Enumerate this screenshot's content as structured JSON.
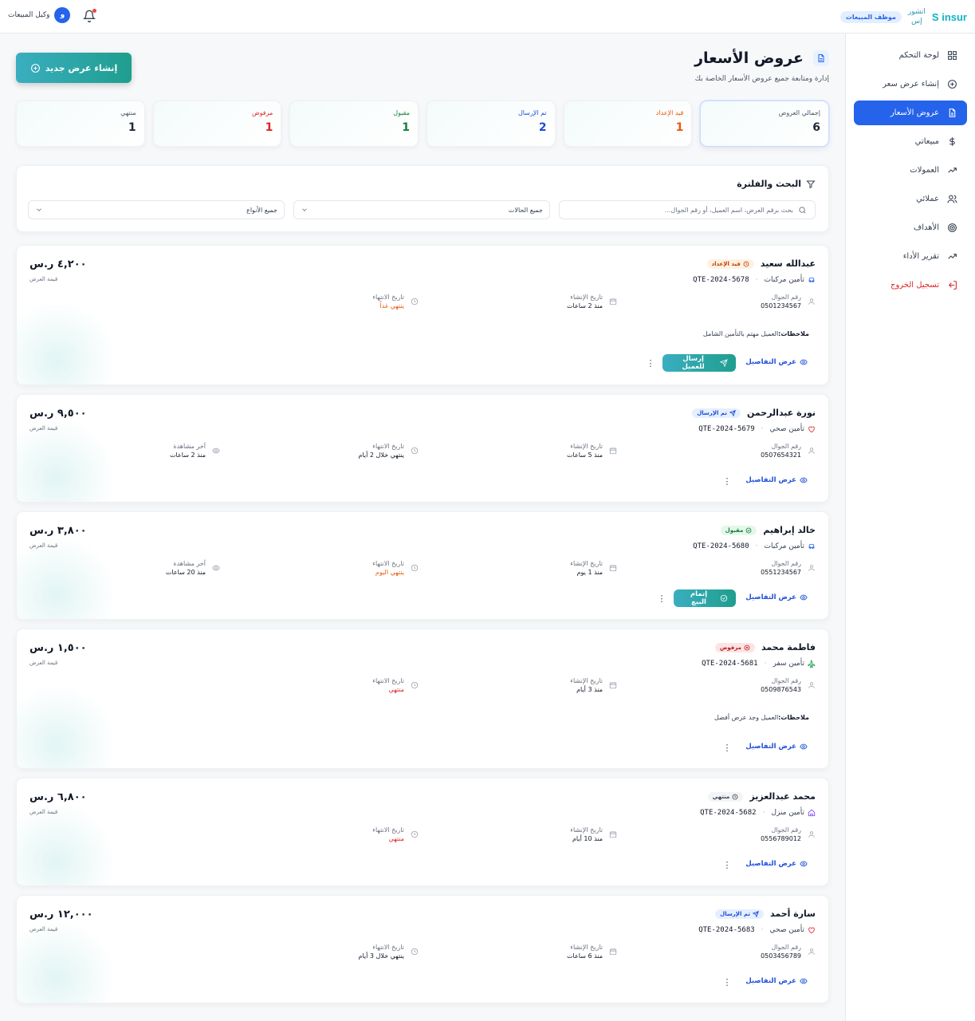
{
  "brand": {
    "name_en": "S insur",
    "name_ar_line1": "انشور",
    "name_ar_line2": "إس",
    "role": "موظف المبيعات"
  },
  "user": {
    "name": "وكيل المبيعات",
    "initial": "و"
  },
  "sidebar": {
    "items": [
      {
        "label": "لوحة التحكم",
        "icon": "dashboard-icon"
      },
      {
        "label": "إنشاء عرض سعر",
        "icon": "plus-circle-icon"
      },
      {
        "label": "عروض الأسعار",
        "icon": "document-icon"
      },
      {
        "label": "مبيعاتي",
        "icon": "dollar-icon"
      },
      {
        "label": "العمولات",
        "icon": "trend-icon"
      },
      {
        "label": "عملائي",
        "icon": "users-icon"
      },
      {
        "label": "الأهداف",
        "icon": "target-icon"
      },
      {
        "label": "تقرير الأداء",
        "icon": "chart-trend-icon"
      },
      {
        "label": "تسجيل الخروج",
        "icon": "logout-icon"
      }
    ]
  },
  "page": {
    "title": "عروض الأسعار",
    "subtitle": "إدارة ومتابعة جميع عروض الأسعار الخاصة بك",
    "create_label": "إنشاء عرض جديد"
  },
  "stats": [
    {
      "label": "إجمالي العروض",
      "value": "6",
      "color": "#111827"
    },
    {
      "label": "قيد الإعداد",
      "value": "1",
      "color": "#ea580c"
    },
    {
      "label": "تم الإرسال",
      "value": "2",
      "color": "#1d4ed8"
    },
    {
      "label": "مقبول",
      "value": "1",
      "color": "#15803d"
    },
    {
      "label": "مرفوض",
      "value": "1",
      "color": "#dc2626"
    },
    {
      "label": "منتهي",
      "value": "1",
      "color": "#374151"
    }
  ],
  "filter": {
    "title": "البحث والفلترة",
    "search_placeholder": "بحث برقم العرض، اسم العميل، أو رقم الجوال...",
    "status_select": "جميع الحالات",
    "type_select": "جميع الأنواع"
  },
  "labels": {
    "phone": "رقم الجوال",
    "created": "تاريخ الإنشاء",
    "expires": "تاريخ الانتهاء",
    "viewed": "آخر مشاهدة",
    "amount": "قيمة العرض",
    "notes": "ملاحظات:",
    "details": "عرض التفاصيل",
    "kebab": "⋮"
  },
  "quotes": [
    {
      "name": "عبدالله سعيد",
      "status": "قيد الإعداد",
      "type": "تأمين مركبات",
      "number": "QTE-2024-5678",
      "phone": "0501234567",
      "created": "منذ 2 ساعات",
      "expires": "ينتهي غداً",
      "amount": "٤,٢٠٠ ر.س",
      "notes": "العميل مهتم بالتأمين الشامل",
      "action": "إرسال للعميل"
    },
    {
      "name": "نورة عبدالرحمن",
      "status": "تم الإرسال",
      "type": "تأمين صحي",
      "number": "QTE-2024-5679",
      "phone": "0507654321",
      "created": "منذ 5 ساعات",
      "expires": "ينتهي خلال 2 أيام",
      "viewed": "منذ 2 ساعات",
      "amount": "٩,٥٠٠ ر.س"
    },
    {
      "name": "خالد إبراهيم",
      "status": "مقبول",
      "type": "تأمين مركبات",
      "number": "QTE-2024-5680",
      "phone": "0551234567",
      "created": "منذ 1 يوم",
      "expires": "ينتهي اليوم",
      "viewed": "منذ 20 ساعات",
      "amount": "٣,٨٠٠ ر.س",
      "action": "إتمام البيع"
    },
    {
      "name": "فاطمة محمد",
      "status": "مرفوض",
      "type": "تأمين سفر",
      "number": "QTE-2024-5681",
      "phone": "0509876543",
      "created": "منذ 3 أيام",
      "expires": "منتهي",
      "amount": "١,٥٠٠ ر.س",
      "notes": "العميل وجد عرض أفضل"
    },
    {
      "name": "محمد عبدالعزيز",
      "status": "منتهي",
      "type": "تأمين منزل",
      "number": "QTE-2024-5682",
      "phone": "0556789012",
      "created": "منذ 10 أيام",
      "expires": "منتهي",
      "amount": "٦,٨٠٠ ر.س"
    },
    {
      "name": "سارة أحمد",
      "status": "تم الإرسال",
      "type": "تأمين صحي",
      "number": "QTE-2024-5683",
      "phone": "0503456789",
      "created": "منذ 6 ساعات",
      "expires": "ينتهي خلال 3 أيام",
      "amount": "١٢,٠٠٠ ر.س"
    }
  ]
}
